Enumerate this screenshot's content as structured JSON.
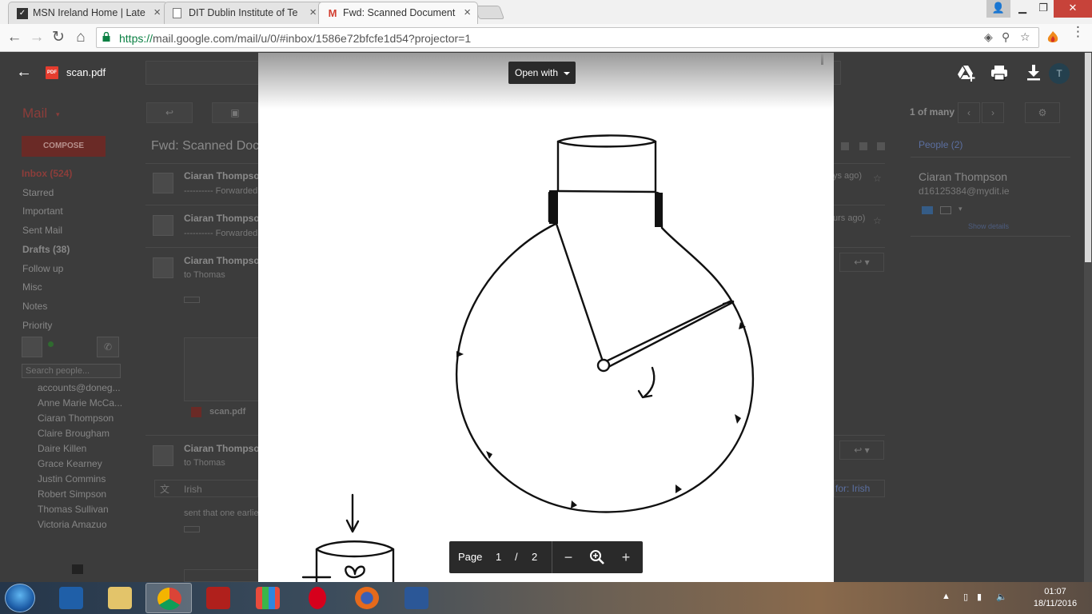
{
  "browser": {
    "tabs": [
      {
        "title": "MSN Ireland Home | Late",
        "favicon": "msn-icon"
      },
      {
        "title": "DIT Dublin Institute of Te",
        "favicon": "page-icon"
      },
      {
        "title": "Fwd: Scanned Document",
        "favicon": "gmail-icon"
      }
    ],
    "url_scheme": "https://",
    "url_rest": "mail.google.com/mail/u/0/#inbox/1586e72bfcfe1d54?projector=1"
  },
  "gmail": {
    "mail_label": "Mail",
    "compose": "COMPOSE",
    "nav": [
      "Inbox (524)",
      "Starred",
      "Important",
      "Sent Mail",
      "Drafts (38)",
      "Follow up",
      "Misc",
      "Notes",
      "Priority"
    ],
    "people_search_placeholder": "Search people...",
    "contacts": [
      "accounts@doneg...",
      "Anne Marie McCa...",
      "Ciaran Thompson",
      "Claire Brougham",
      "Daire Killen",
      "Grace Kearney",
      "Justin Commins",
      "Robert Simpson",
      "Thomas Sullivan",
      "Victoria Amazuo"
    ],
    "subject": "Fwd: Scanned Doc",
    "count": "1 of many",
    "thread": [
      {
        "sender": "Ciaran Thompson",
        "snippet": "---------- Forwarded",
        "time": "ys ago)"
      },
      {
        "sender": "Ciaran Thompson",
        "snippet": "---------- Forwarded",
        "time": "urs ago)"
      },
      {
        "sender": "Ciaran Thompson",
        "snippet": "to Thomas"
      },
      {
        "sender": "Ciaran Thompson",
        "snippet": "to Thomas"
      }
    ],
    "attachment_name": "scan.pdf",
    "translate_lang": "Irish",
    "translate_right": "for: Irish",
    "body_snippet": "sent that one earlie",
    "people_header": "People (2)",
    "person_name": "Ciaran Thompson",
    "person_email": "d16125384@mydit.ie",
    "show_details": "Show details"
  },
  "viewer": {
    "file_name": "scan.pdf",
    "badge": "PDF",
    "open_with": "Open with",
    "page_label": "Page",
    "current_page": "1",
    "page_sep": "/",
    "total_pages": "2",
    "account_initial": "T"
  },
  "taskbar": {
    "time": "01:07",
    "date": "18/11/2016"
  },
  "colors": {
    "pdf_badge": "#e53c2e",
    "gmail_accent": "#8c3d3a",
    "secure_url": "#0b8043"
  }
}
